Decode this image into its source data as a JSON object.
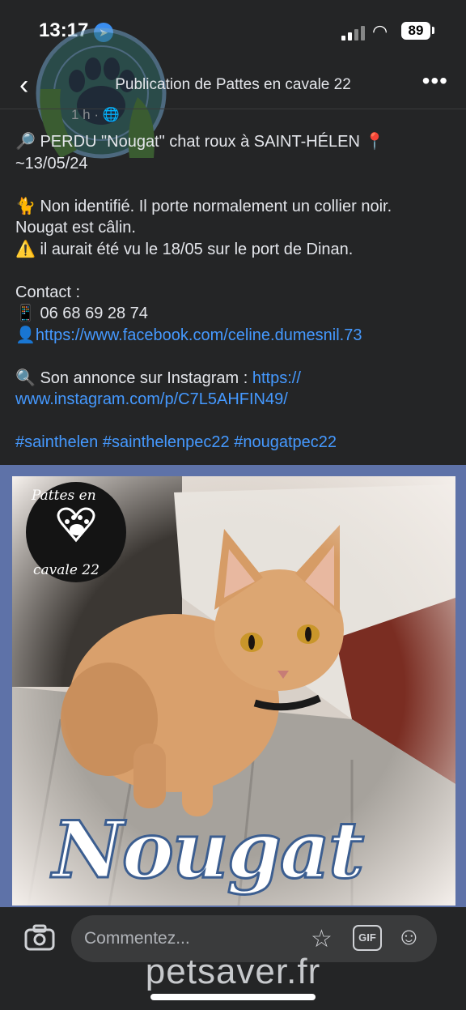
{
  "status_bar": {
    "time": "13:17",
    "battery": "89"
  },
  "nav": {
    "title": "Publication de Pattes en cavale 22",
    "meta": "1 h · 🌐"
  },
  "post": {
    "line1": "🔎 PERDU \"Nougat\" chat roux à SAINT-HÉLEN 📍",
    "line2": "~13/05/24",
    "line3": "🐈 Non identifié. Il porte normalement un collier noir.",
    "line4": "Nougat est câlin.",
    "line5": "⚠️ il aurait été vu le 18/05 sur le port de Dinan.",
    "contact_label": "Contact :",
    "phone": "📱 06 68 69 28 74",
    "facebook_icon": "👤",
    "facebook_url": "https://www.facebook.com/celine.dumesnil.73",
    "instagram_prefix": "🔍 Son annonce sur Instagram : ",
    "instagram_url_part1": "https://",
    "instagram_url_part2": "www.instagram.com/p/C7L5AHFIN49/",
    "hashtags": "#sainthelen #sainthelenpec22 #nougatpec22"
  },
  "photo": {
    "logo_top": "Pattes en",
    "logo_bottom": "cavale 22",
    "name_caption": "Nougat"
  },
  "comment": {
    "placeholder": "Commentez..."
  },
  "watermark": "petsaver.fr",
  "icons": [
    "back-chevron-icon",
    "more-icon",
    "camera-icon",
    "sticker-icon",
    "gif-icon",
    "emoji-icon",
    "location-arrow-icon",
    "signal-icon",
    "wifi-icon"
  ],
  "colors": {
    "background": "#242526",
    "link": "#4599ff",
    "frame": "#5e72a8"
  }
}
